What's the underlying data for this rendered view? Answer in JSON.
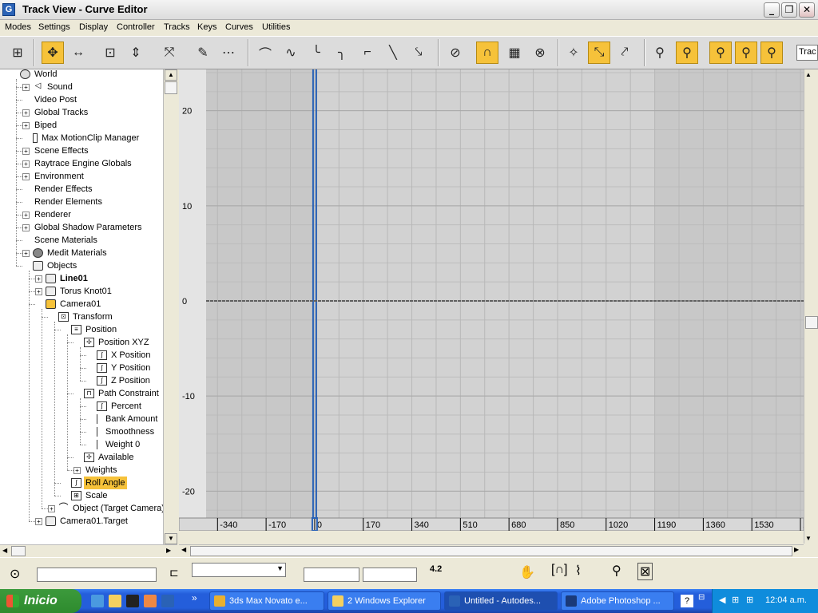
{
  "window": {
    "title": "Track View - Curve Editor",
    "app_icon": "G"
  },
  "menus": [
    "Modes",
    "Settings",
    "Display",
    "Controller",
    "Tracks",
    "Keys",
    "Curves",
    "Utilities"
  ],
  "toolbar": {
    "track_field_value": "Trac",
    "active_tool": "move-keys"
  },
  "tree": [
    {
      "label": "World",
      "depth": 0,
      "icon": "globe-icon",
      "exp": ""
    },
    {
      "label": "Sound",
      "depth": 1,
      "icon": "speaker-icon",
      "exp": "+"
    },
    {
      "label": "Video Post",
      "depth": 1,
      "icon": "",
      "exp": ""
    },
    {
      "label": "Global Tracks",
      "depth": 1,
      "icon": "",
      "exp": "+"
    },
    {
      "label": "Biped",
      "depth": 1,
      "icon": "",
      "exp": "+"
    },
    {
      "label": "Max MotionClip Manager",
      "depth": 1,
      "icon": "clip-icon",
      "exp": ""
    },
    {
      "label": "Scene Effects",
      "depth": 1,
      "icon": "",
      "exp": "+"
    },
    {
      "label": "Raytrace Engine Globals",
      "depth": 1,
      "icon": "",
      "exp": "+"
    },
    {
      "label": "Environment",
      "depth": 1,
      "icon": "",
      "exp": "+"
    },
    {
      "label": "Render Effects",
      "depth": 1,
      "icon": "",
      "exp": ""
    },
    {
      "label": "Render Elements",
      "depth": 1,
      "icon": "",
      "exp": ""
    },
    {
      "label": "Renderer",
      "depth": 1,
      "icon": "",
      "exp": "+"
    },
    {
      "label": "Global Shadow Parameters",
      "depth": 1,
      "icon": "",
      "exp": "+"
    },
    {
      "label": "Scene Materials",
      "depth": 1,
      "icon": "",
      "exp": ""
    },
    {
      "label": "Medit Materials",
      "depth": 1,
      "icon": "sphere-icon",
      "exp": "+"
    },
    {
      "label": "Objects",
      "depth": 1,
      "icon": "cube-icon",
      "exp": ""
    },
    {
      "label": "Line01",
      "depth": 2,
      "icon": "cube-icon",
      "exp": "+",
      "bold": true
    },
    {
      "label": "Torus Knot01",
      "depth": 2,
      "icon": "cube-icon",
      "exp": "+"
    },
    {
      "label": "Camera01",
      "depth": 2,
      "icon": "cube-icon",
      "exp": "",
      "highlight_icon": true
    },
    {
      "label": "Transform",
      "depth": 3,
      "icon": "transform-icon",
      "exp": ""
    },
    {
      "label": "Position",
      "depth": 4,
      "icon": "list-icon",
      "exp": ""
    },
    {
      "label": "Position XYZ",
      "depth": 5,
      "icon": "xyz-icon",
      "exp": ""
    },
    {
      "label": "X Position",
      "depth": 6,
      "icon": "curve-icon",
      "exp": ""
    },
    {
      "label": "Y Position",
      "depth": 6,
      "icon": "curve-icon",
      "exp": ""
    },
    {
      "label": "Z Position",
      "depth": 6,
      "icon": "curve-icon",
      "exp": ""
    },
    {
      "label": "Path Constraint",
      "depth": 5,
      "icon": "lock-icon",
      "exp": ""
    },
    {
      "label": "Percent",
      "depth": 6,
      "icon": "curve-icon",
      "exp": ""
    },
    {
      "label": "Bank Amount",
      "depth": 6,
      "icon": "bracket-icon",
      "exp": ""
    },
    {
      "label": "Smoothness",
      "depth": 6,
      "icon": "bracket-icon",
      "exp": ""
    },
    {
      "label": "Weight 0",
      "depth": 6,
      "icon": "bracket-icon",
      "exp": ""
    },
    {
      "label": "Available",
      "depth": 5,
      "icon": "xyz-icon",
      "exp": ""
    },
    {
      "label": "Weights",
      "depth": 5,
      "icon": "",
      "exp": "+"
    },
    {
      "label": "Roll Angle",
      "depth": 4,
      "icon": "curve-icon",
      "exp": "",
      "selected": true
    },
    {
      "label": "Scale",
      "depth": 4,
      "icon": "scale-icon",
      "exp": ""
    },
    {
      "label": "Object (Target Camera)",
      "depth": 3,
      "icon": "camera-icon",
      "exp": "+"
    },
    {
      "label": "Camera01.Target",
      "depth": 2,
      "icon": "cube-icon",
      "exp": "+"
    }
  ],
  "curve": {
    "y_ticks": [
      "20",
      "10",
      "0",
      "-10",
      "-20"
    ],
    "x_ticks": [
      "-340",
      "-170",
      "0",
      "170",
      "340",
      "510",
      "680",
      "850",
      "1020",
      "1190",
      "1360",
      "1530",
      "1"
    ],
    "y_range": [
      -24,
      24
    ],
    "x_range": [
      -380,
      1700
    ],
    "active_range": [
      0,
      1190
    ],
    "current_frame": 0,
    "roll_angle_value": 0
  },
  "status": {
    "value_readout": "4.2"
  },
  "taskbar": {
    "start_label": "Inicio",
    "tasks": [
      {
        "label": "3ds Max Novato e...",
        "icon_color": "#e8b030"
      },
      {
        "label": "2 Windows Explorer",
        "icon_color": "#f4d060"
      },
      {
        "label": "Untitled - Autodes...",
        "icon_color": "#2a62b6",
        "active": true
      },
      {
        "label": "Adobe Photoshop ...",
        "icon_color": "#1a3a7a"
      }
    ],
    "clock": "12:04 a.m."
  }
}
